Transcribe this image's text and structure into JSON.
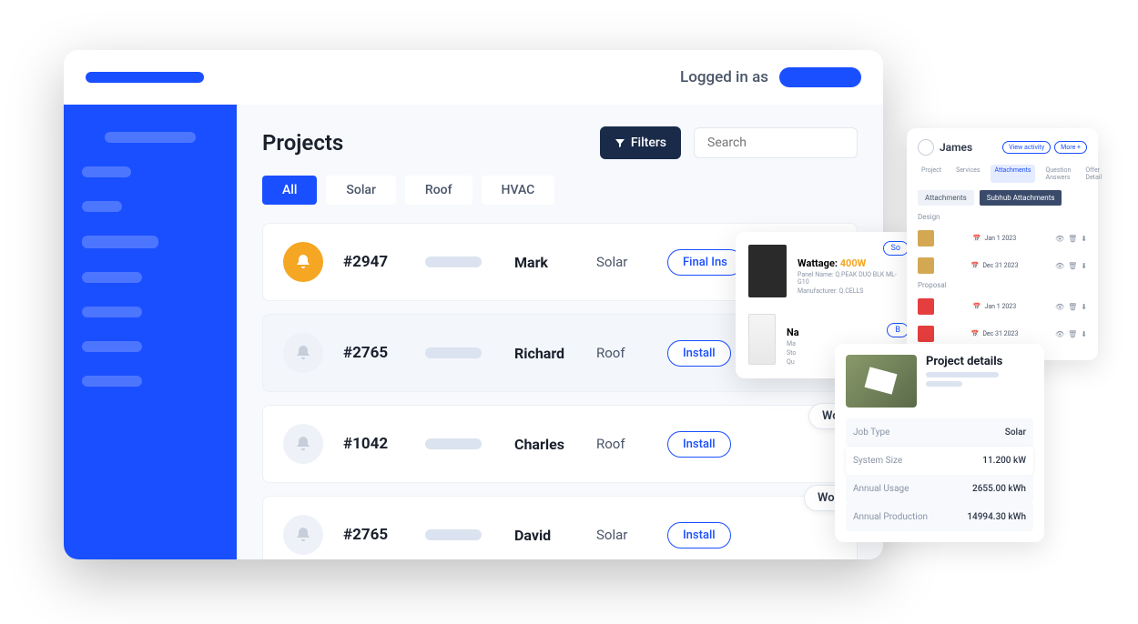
{
  "header": {
    "login_label": "Logged in as"
  },
  "main": {
    "title": "Projects",
    "filters_label": "Filters",
    "search_placeholder": "Search",
    "tabs": [
      "All",
      "Solar",
      "Roof",
      "HVAC"
    ]
  },
  "projects": [
    {
      "id": "#2947",
      "name": "Mark",
      "type": "Solar",
      "action": "Final Ins",
      "bell_active": true
    },
    {
      "id": "#2765",
      "name": "Richard",
      "type": "Roof",
      "action": "Install",
      "bell_active": false
    },
    {
      "id": "#1042",
      "name": "Charles",
      "type": "Roof",
      "action": "Install",
      "bell_active": false
    },
    {
      "id": "#2765",
      "name": "David",
      "type": "Solar",
      "action": "Install",
      "bell_active": false
    }
  ],
  "work_order_label": "Wo",
  "panel_card": {
    "badge1": "So",
    "wattage_label": "Wattage:",
    "wattage_value": "400W",
    "panel_name_label": "Panel Name:",
    "panel_name_value": "Q.PEAK DUO BLK ML-G10",
    "manufacturer_label": "Manufacturer:",
    "manufacturer_value": "Q.CELLS",
    "badge2": "B",
    "row2_name_label": "Na",
    "row2_sub1": "Ma",
    "row2_sub2": "Sto",
    "row2_sub3": "Qu"
  },
  "attachments": {
    "user_name": "James",
    "view_activity": "View activity",
    "more": "More +",
    "nav_tabs": [
      "Project",
      "Services",
      "Attachments",
      "Question Answers",
      "Offer Detail"
    ],
    "sub_tabs": [
      "Attachments",
      "Subhub Attachments"
    ],
    "section_design": "Design",
    "section_proposal": "Proposal",
    "files": {
      "design": [
        {
          "date": "Jan 1  2023"
        },
        {
          "date": "Dec 31  2023"
        }
      ],
      "proposal": [
        {
          "date": "Jan 1  2023"
        },
        {
          "date": "Dec 31  2023"
        }
      ]
    }
  },
  "details": {
    "title": "Project details",
    "rows": [
      {
        "label": "Job Type",
        "value": "Solar"
      },
      {
        "label": "System Size",
        "value": "11.200 kW"
      },
      {
        "label": "Annual Usage",
        "value": "2655.00 kWh"
      },
      {
        "label": "Annual Production",
        "value": "14994.30 kWh"
      }
    ]
  }
}
